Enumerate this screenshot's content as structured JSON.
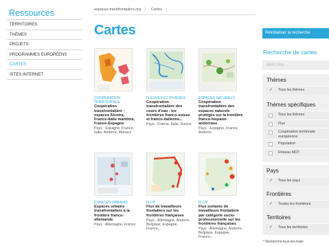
{
  "sidebar": {
    "title": "Ressources",
    "items": [
      {
        "label": "TERRITOIRES",
        "active": false
      },
      {
        "label": "THÈMES",
        "active": false
      },
      {
        "label": "PROJETS",
        "active": false
      },
      {
        "label": "PROGRAMMES EUROPÉENS",
        "active": false
      },
      {
        "label": "CARTES",
        "active": true
      },
      {
        "label": "SITES INTERNET",
        "active": false
      }
    ]
  },
  "breadcrumb": {
    "items": [
      "espaces-transfrontaliers.org",
      "Cartes"
    ],
    "separator": "〉"
  },
  "page": {
    "title": "Cartes"
  },
  "cards": [
    {
      "category": "COOPÉRATION TERRITORIALE",
      "title": "Coopération transfrontalière : espaces Alcotra, France-Italie maritime, France-Espagne",
      "pays": "Pays : Espagne, France, Italie, Andorre, Monaco"
    },
    {
      "category": "FLEUVES ET RIVIÈRES",
      "title": "Coopération transfrontalière des cours d'eau : les frontières franco-suisse et franco-italienne...",
      "pays": "Pays : France, Italie, Suisse"
    },
    {
      "category": "ESPACES NATURELS",
      "title": "Coopération transfrontalière des espaces naturels protégés sur la frontière franco-hispano-andorrane",
      "pays": "Pays : Espagne, France, Andorre"
    },
    {
      "category": "ESPACES URBAINS",
      "title": "Espaces urbains transfrontaliers à la frontière franco-allemande",
      "pays": "Pays : Allemagne, France"
    },
    {
      "category": "FLUX",
      "title": "Flux de travailleurs frontaliers sur les frontières françaises",
      "pays": "Pays : Allemagne, Andorre, Belgique, Espagne, France,..."
    },
    {
      "category": "FLUX",
      "title": "Flux sortants de travailleurs frontaliers par catégorie socio-professionnelle sur les frontières françaises",
      "pays": "Pays : Allemagne, Andorre, Belgique, Espagne, France,..."
    }
  ],
  "panel": {
    "reset_label": "Réinitialiser la recherche",
    "search_title": "Recherche de cartes",
    "search_placeholder": "Mots clés",
    "themes": {
      "title": "Thèmes",
      "options": [
        {
          "label": "Tous les thèmes",
          "checked": true
        }
      ]
    },
    "themes_specific": {
      "title": "Thèmes spécifiques",
      "options": [
        {
          "label": "Tous les thèmes",
          "checked": false
        },
        {
          "label": "Flux",
          "checked": false
        },
        {
          "label": "Coopération territoriale européenne",
          "checked": false
        },
        {
          "label": "Population",
          "checked": false
        },
        {
          "label": "Réseau MOT",
          "checked": false
        }
      ]
    },
    "pays": {
      "title": "Pays",
      "options": [
        {
          "label": "Tous les pays",
          "checked": true
        }
      ]
    },
    "frontieres": {
      "title": "Frontières",
      "options": [
        {
          "label": "Toutes les frontières",
          "checked": true
        }
      ]
    },
    "territoires": {
      "title": "Territoires",
      "options": [
        {
          "label": "Tous les territoires",
          "checked": true
        }
      ]
    },
    "note": "* Recherche tous les mots"
  },
  "colors": {
    "accent": "#2aa6d8",
    "panel_bg": "#f0f0f0"
  }
}
